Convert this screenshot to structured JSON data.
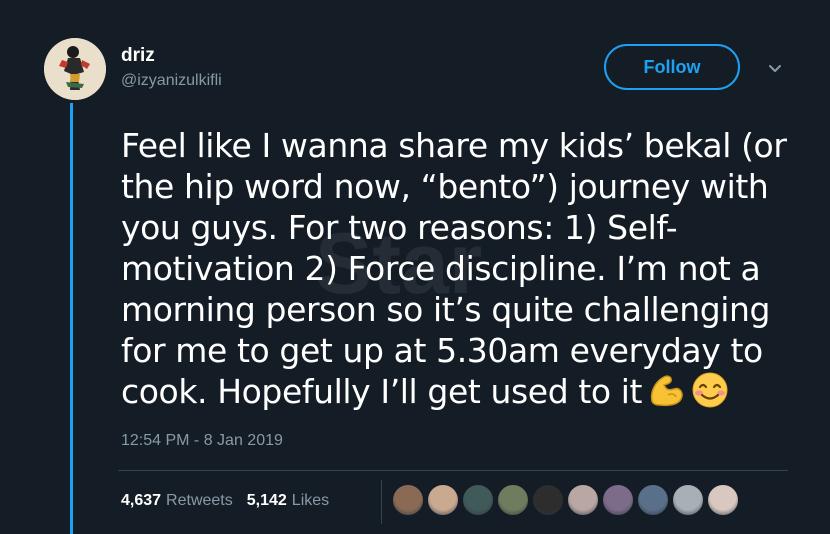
{
  "user": {
    "display_name": "driz",
    "handle": "@izyanizulkifli"
  },
  "follow_label": "Follow",
  "tweet": {
    "text": "Feel like I wanna share my kids’ bekal (or\nthe hip word now, “bento”) journey with\nyou guys. For two reasons: 1) Self-\nmotivation 2) Force discipline. I’m not a\nmorning person so it’s quite challenging\nfor me to get up at 5.30am everyday to\ncook. Hopefully I’ll get used to it",
    "emojis": [
      "flexed-biceps",
      "smiling-face-with-smiling-eyes"
    ],
    "timestamp": "12:54 PM - 8 Jan 2019"
  },
  "stats": {
    "retweets_count": "4,637",
    "retweets_label": "Retweets",
    "likes_count": "5,142",
    "likes_label": "Likes"
  },
  "watermark": "Star",
  "liker_colors": [
    "#8a6a55",
    "#c9a98f",
    "#3f5a58",
    "#6f7d5e",
    "#2d2d2d",
    "#b9a7a4",
    "#7d6b8a",
    "#5a6f8a",
    "#a8b0b6",
    "#d8c8c0"
  ],
  "colors": {
    "background": "#141d26",
    "accent": "#1da1f2",
    "secondary_text": "#8899a6"
  }
}
